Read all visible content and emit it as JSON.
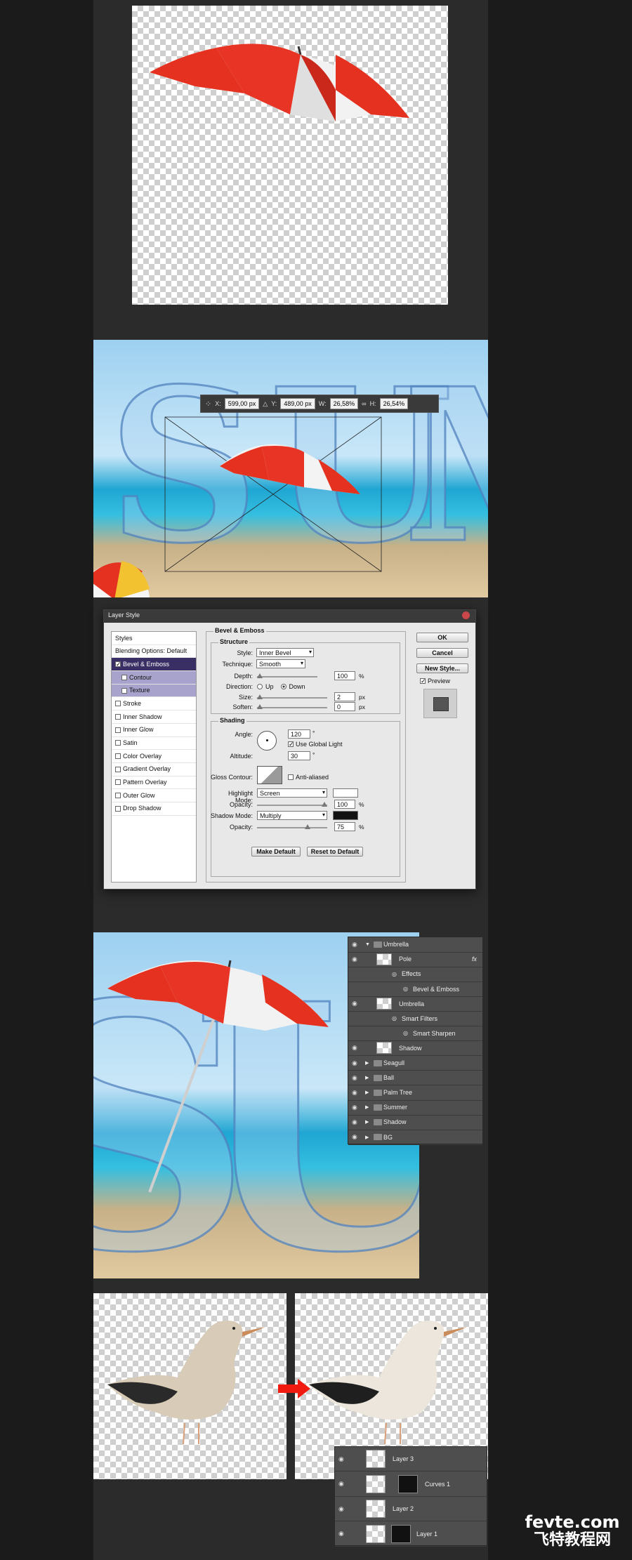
{
  "transform": {
    "x_label": "X:",
    "x_value": "599,00 px",
    "y_label": "Y:",
    "y_value": "489,00 px",
    "w_label": "W:",
    "w_value": "26,58%",
    "h_label": "H:",
    "h_value": "26,54%"
  },
  "dialog": {
    "title": "Layer Style",
    "styles_header": "Styles",
    "blending": "Blending Options: Default",
    "styles": [
      {
        "label": "Bevel & Emboss",
        "checked": true
      },
      {
        "label": "Contour",
        "checked": false
      },
      {
        "label": "Texture",
        "checked": false
      },
      {
        "label": "Stroke",
        "checked": false
      },
      {
        "label": "Inner Shadow",
        "checked": false
      },
      {
        "label": "Inner Glow",
        "checked": false
      },
      {
        "label": "Satin",
        "checked": false
      },
      {
        "label": "Color Overlay",
        "checked": false
      },
      {
        "label": "Gradient Overlay",
        "checked": false
      },
      {
        "label": "Pattern Overlay",
        "checked": false
      },
      {
        "label": "Outer Glow",
        "checked": false
      },
      {
        "label": "Drop Shadow",
        "checked": false
      }
    ],
    "section_title": "Bevel & Emboss",
    "structure": "Structure",
    "style_label": "Style:",
    "style_value": "Inner Bevel",
    "technique_label": "Technique:",
    "technique_value": "Smooth",
    "depth_label": "Depth:",
    "depth_value": "100",
    "depth_unit": "%",
    "direction_label": "Direction:",
    "dir_up": "Up",
    "dir_down": "Down",
    "size_label": "Size:",
    "size_value": "2",
    "size_unit": "px",
    "soften_label": "Soften:",
    "soften_value": "0",
    "soften_unit": "px",
    "shading": "Shading",
    "angle_label": "Angle:",
    "angle_value": "120",
    "angle_unit": "°",
    "global_light": "Use Global Light",
    "altitude_label": "Altitude:",
    "altitude_value": "30",
    "altitude_unit": "°",
    "gloss_label": "Gloss Contour:",
    "anti_aliased": "Anti-aliased",
    "highlight_label": "Highlight Mode:",
    "highlight_value": "Screen",
    "opacity_label": "Opacity:",
    "highlight_opacity": "100",
    "opacity_unit": "%",
    "shadow_label": "Shadow Mode:",
    "shadow_value": "Multiply",
    "shadow_opacity": "75",
    "make_default": "Make Default",
    "reset_default": "Reset to Default",
    "ok": "OK",
    "cancel": "Cancel",
    "new_style": "New Style...",
    "preview": "Preview",
    "colors": {
      "highlight": "#ffffff",
      "shadow": "#111111"
    }
  },
  "layers1": [
    {
      "label": "Umbrella",
      "type": "group-open"
    },
    {
      "label": "Pole",
      "type": "layer",
      "fx": "fx"
    },
    {
      "label": "Effects",
      "type": "effects"
    },
    {
      "label": "Bevel & Emboss",
      "type": "effect"
    },
    {
      "label": "Umbrella",
      "type": "smart"
    },
    {
      "label": "Smart Filters",
      "type": "effects"
    },
    {
      "label": "Smart Sharpen",
      "type": "effect"
    },
    {
      "label": "Shadow",
      "type": "layer"
    },
    {
      "label": "Seagull",
      "type": "group"
    },
    {
      "label": "Ball",
      "type": "group"
    },
    {
      "label": "Palm Tree",
      "type": "group"
    },
    {
      "label": "Summer",
      "type": "group"
    },
    {
      "label": "Shadow",
      "type": "group"
    },
    {
      "label": "BG",
      "type": "group"
    }
  ],
  "layers2": [
    {
      "label": "Layer 3"
    },
    {
      "label": "Curves 1"
    },
    {
      "label": "Layer 2"
    },
    {
      "label": "Layer 1"
    }
  ],
  "watermark": {
    "line1": "fevte.com",
    "line2": "飞特教程网"
  }
}
